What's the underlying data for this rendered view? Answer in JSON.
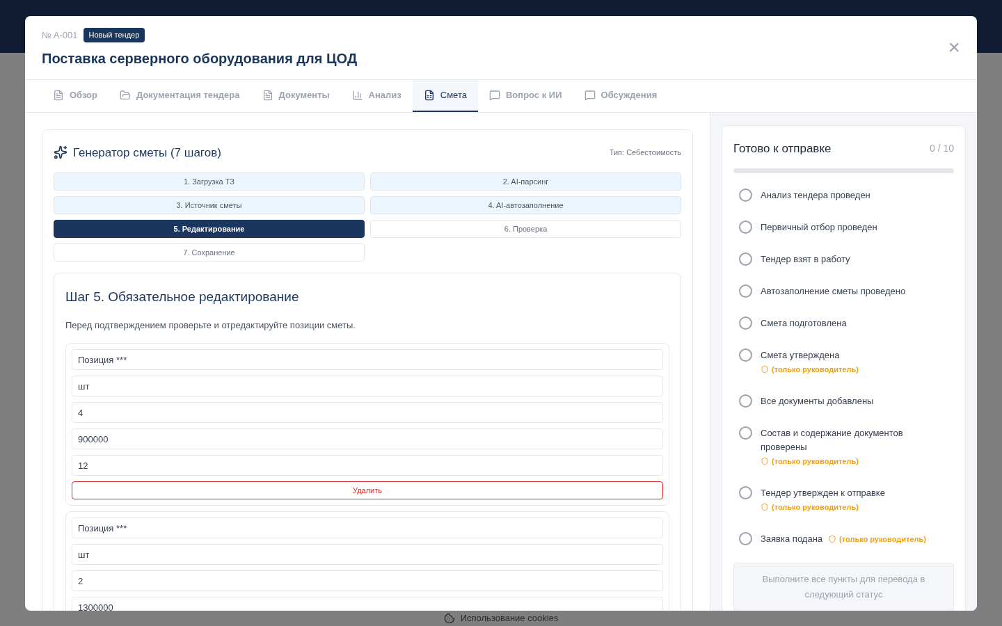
{
  "footer": {
    "cookies": "Использование cookies"
  },
  "modal": {
    "number": "№ A-001",
    "badge": "Новый тендер",
    "title": "Поставка серверного оборудования для ЦОД",
    "close": "×"
  },
  "tabs": [
    {
      "label": "Обзор",
      "selected": false
    },
    {
      "label": "Документация тендера",
      "selected": false
    },
    {
      "label": "Документы",
      "selected": false
    },
    {
      "label": "Анализ",
      "selected": false
    },
    {
      "label": "Смета",
      "selected": true
    },
    {
      "label": "Вопрос к ИИ",
      "selected": false
    },
    {
      "label": "Обсуждения",
      "selected": false
    }
  ],
  "generator": {
    "title": "Генератор сметы (7 шагов)",
    "type": "Тип: Себестоимость",
    "steps": [
      {
        "label": "1. Загрузка ТЗ",
        "completed": true,
        "selected": false
      },
      {
        "label": "2. AI-парсинг",
        "completed": true,
        "selected": false
      },
      {
        "label": "3. Источник сметы",
        "completed": true,
        "selected": false
      },
      {
        "label": "4. AI-автозаполнение",
        "completed": true,
        "selected": false
      },
      {
        "label": "5. Редактирование",
        "completed": false,
        "selected": true
      },
      {
        "label": "6. Проверка",
        "completed": false,
        "selected": false
      },
      {
        "label": "7. Сохранение",
        "completed": false,
        "selected": false
      }
    ],
    "step_title": "Шаг 5. Обязательное редактирование",
    "step_hint": "Перед подтверждением проверьте и отредактируйте позиции сметы.",
    "positions": [
      {
        "fields": [
          "Позиция ***",
          "шт",
          "4",
          "900000",
          "12"
        ],
        "delete": "Удалить"
      },
      {
        "fields": [
          "Позиция ***",
          "шт",
          "2",
          "1300000"
        ]
      }
    ]
  },
  "checklist": {
    "title": "Готово к отправке",
    "count": "0 / 10",
    "level": 0,
    "items": [
      {
        "label": "Анализ тендера проведен",
        "checked": false
      },
      {
        "label": "Первичный отбор проведен",
        "checked": false
      },
      {
        "label": "Тендер взят в работу",
        "checked": false
      },
      {
        "label": "Автозаполнение сметы проведено",
        "checked": false
      },
      {
        "label": "Смета подготовлена",
        "checked": false
      },
      {
        "label": "Смета утверждена",
        "checked": false,
        "note": "(только руководитель)"
      },
      {
        "label": "Все документы добавлены",
        "checked": false
      },
      {
        "label": "Состав и содержание документов проверены",
        "checked": false,
        "note": "(только руководитель)"
      },
      {
        "label": "Тендер утвержден к отправке",
        "checked": false,
        "note": "(только руководитель)"
      },
      {
        "label": "Заявка подана",
        "checked": false,
        "note": "(только руководитель)"
      }
    ],
    "submit": "Выполните все пункты для перевода в следующий статус",
    "submit_disabled": true
  }
}
